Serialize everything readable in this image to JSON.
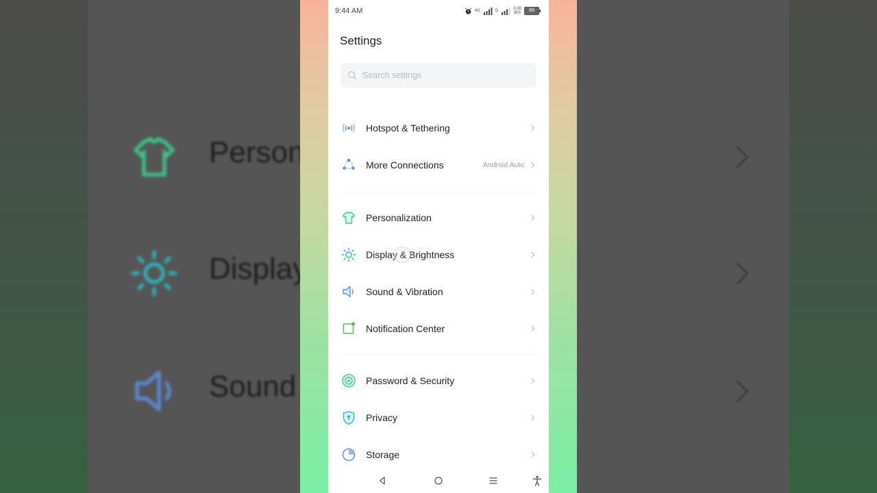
{
  "status_bar": {
    "time": "9:44 AM",
    "net1": "4G",
    "net2": "G",
    "speed": "0.00",
    "speed_unit": "B/S",
    "battery": "89"
  },
  "header": {
    "title": "Settings"
  },
  "search": {
    "placeholder": "Search settings"
  },
  "items": [
    {
      "label": "Hotspot & Tethering",
      "icon": "hotspot-icon",
      "color": "#5b8de0"
    },
    {
      "label": "More Connections",
      "value": "Android Auto",
      "icon": "connections-icon",
      "color": "#5b8de0"
    },
    {
      "label": "Personalization",
      "icon": "shirt-icon",
      "color": "#3ec98a"
    },
    {
      "label": "Display & Brightness",
      "icon": "sun-icon",
      "color": "#2fb7c4"
    },
    {
      "label": "Sound & Vibration",
      "icon": "speaker-icon",
      "color": "#5b8de0"
    },
    {
      "label": "Notification Center",
      "icon": "notification-icon",
      "color": "#4cc452"
    },
    {
      "label": "Password & Security",
      "icon": "security-icon",
      "color": "#3ec98a"
    },
    {
      "label": "Privacy",
      "icon": "shield-icon",
      "color": "#2fb7c4"
    },
    {
      "label": "Storage",
      "icon": "storage-icon",
      "color": "#5b8de0"
    }
  ],
  "background_text": {
    "row1": "Person",
    "row2": "Display",
    "row3": "Sound"
  }
}
